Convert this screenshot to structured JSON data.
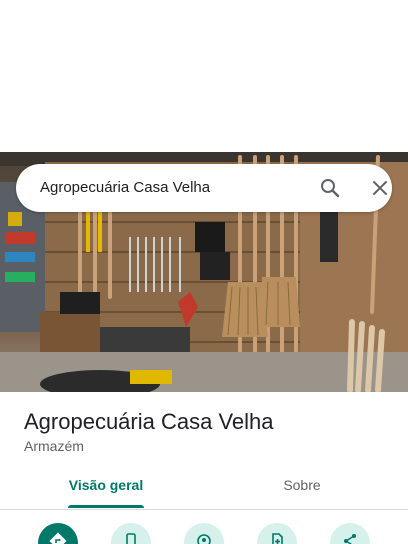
{
  "search": {
    "query": "Agropecuária Casa Velha"
  },
  "place": {
    "name": "Agropecuária Casa Velha",
    "category": "Armazém"
  },
  "tabs": [
    {
      "label": "Visão geral",
      "selected": true
    },
    {
      "label": "Sobre",
      "selected": false
    }
  ],
  "actions": [
    {
      "icon": "directions-icon"
    },
    {
      "icon": "phone-icon"
    },
    {
      "icon": "nearby-icon"
    },
    {
      "icon": "save-icon"
    },
    {
      "icon": "share-icon"
    }
  ],
  "colors": {
    "accent": "#00796b",
    "action_bg": "#d6f0ec",
    "text_primary": "#202124",
    "text_secondary": "#5f6368"
  }
}
